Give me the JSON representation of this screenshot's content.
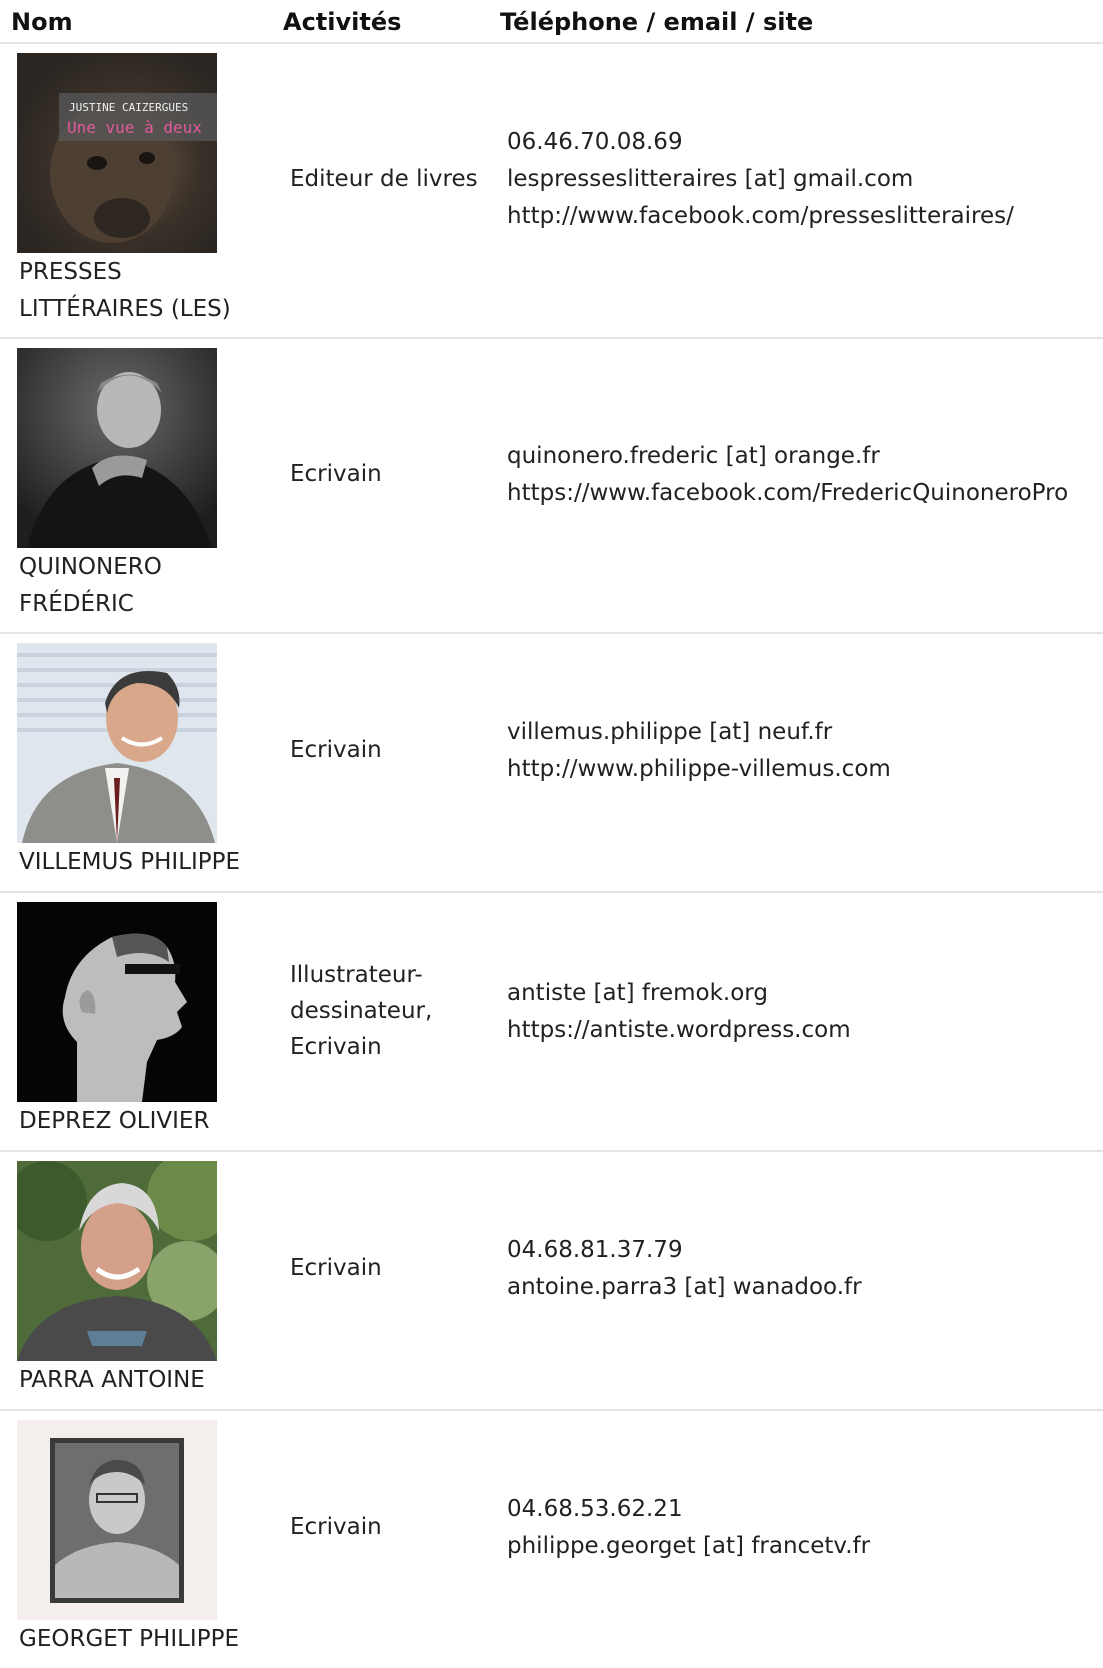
{
  "table": {
    "headers": {
      "nom": "Nom",
      "activites": "Activités",
      "contact": "Téléphone / email / site"
    },
    "rows": [
      {
        "name_lines": [
          "PRESSES",
          "LITTÉRAIRES (LES)"
        ],
        "activity_lines": [
          "Editeur de livres"
        ],
        "contact_lines": [
          "06.46.70.08.69",
          "lespresseslitteraires [at] gmail.com",
          "http://www.facebook.com/presseslitteraires/"
        ],
        "photo": {
          "icon": "book-cover-image",
          "cover_author": "JUSTINE CAIZERGUES",
          "cover_title": "Une vue à deux",
          "title_color": "#e05a9c"
        }
      },
      {
        "name_lines": [
          "QUINONERO",
          "FRÉDÉRIC"
        ],
        "activity_lines": [
          "Ecrivain"
        ],
        "contact_lines": [
          "quinonero.frederic [at] orange.fr",
          "https://www.facebook.com/FredericQuinoneroPro"
        ],
        "photo": {
          "icon": "portrait-photo"
        }
      },
      {
        "name_lines": [
          "VILLEMUS PHILIPPE"
        ],
        "activity_lines": [
          "Ecrivain"
        ],
        "contact_lines": [
          "villemus.philippe [at] neuf.fr",
          "http://www.philippe-villemus.com"
        ],
        "photo": {
          "icon": "portrait-photo"
        }
      },
      {
        "name_lines": [
          "DEPREZ OLIVIER"
        ],
        "activity_lines": [
          "Illustrateur-",
          "dessinateur,",
          "Ecrivain"
        ],
        "contact_lines": [
          "antiste [at] fremok.org",
          "https://antiste.wordpress.com"
        ],
        "photo": {
          "icon": "profile-silhouette-photo"
        }
      },
      {
        "name_lines": [
          "PARRA ANTOINE"
        ],
        "activity_lines": [
          "Ecrivain"
        ],
        "contact_lines": [
          "04.68.81.37.79",
          "antoine.parra3 [at] wanadoo.fr"
        ],
        "photo": {
          "icon": "portrait-photo"
        }
      },
      {
        "name_lines": [
          "GEORGET PHILIPPE"
        ],
        "activity_lines": [
          "Ecrivain"
        ],
        "contact_lines": [
          "04.68.53.62.21",
          "philippe.georget [at] francetv.fr"
        ],
        "photo": {
          "icon": "portrait-photo"
        }
      }
    ]
  }
}
